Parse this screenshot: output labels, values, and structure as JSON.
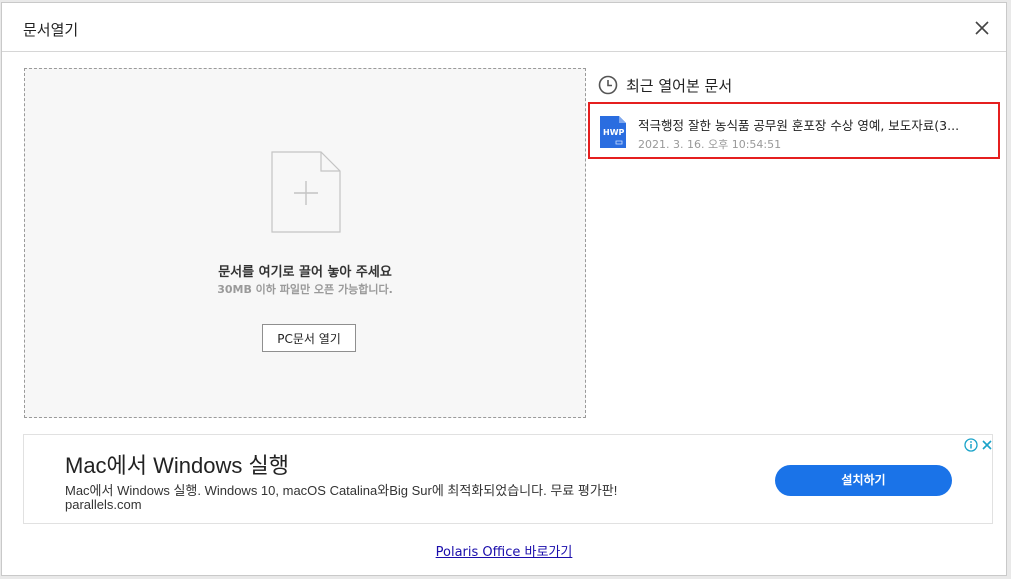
{
  "dialog": {
    "title": "문서열기",
    "close_icon": "close-icon"
  },
  "dropzone": {
    "title": "문서를 여기로 끌어 놓아 주세요",
    "subtitle": "30MB 이하 파일만 오픈 가능합니다.",
    "open_button_label": "PC문서 열기",
    "icon": "add-document-icon"
  },
  "recent": {
    "title": "최근 열어본 문서",
    "icon": "clock-icon",
    "items": [
      {
        "name": "적극행정 잘한 농식품 공무원 훈포장 수상 영예, 보도자료(3...",
        "date": "2021. 3. 16. 오후 10:54:51",
        "icon": "hwp-file-icon",
        "icon_text": "HWP"
      }
    ]
  },
  "ad": {
    "headline": "Mac에서 Windows 실행",
    "description": "Mac에서 Windows 실행. Windows 10, macOS Catalina와Big Sur에 최적화되었습니다. 무료 평가판!",
    "url": "parallels.com",
    "cta_label": "설치하기",
    "cta_color": "#1a73e8"
  },
  "footer": {
    "link_label": "Polaris Office 바로가기"
  },
  "colors": {
    "highlight_border": "#e51f1f",
    "hwp_blue": "#2a6de0"
  }
}
